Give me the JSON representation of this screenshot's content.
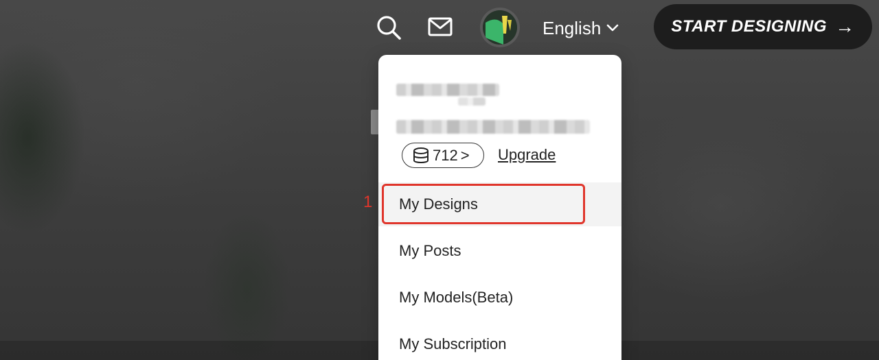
{
  "header": {
    "language": "English",
    "cta_label": "START DESIGNING",
    "cta_arrow": "→",
    "icons": {
      "search": "search-icon",
      "mail": "mail-icon",
      "chevron": "chevron-down-icon",
      "credits": "database-icon"
    }
  },
  "dropdown": {
    "credits": "712",
    "credits_suffix": ">",
    "upgrade_label": "Upgrade",
    "items": [
      {
        "label": "My Designs"
      },
      {
        "label": "My Posts"
      },
      {
        "label": "My Models(Beta)"
      },
      {
        "label": "My Subscription"
      }
    ]
  },
  "annotation": {
    "number": "1",
    "color": "#e0352b"
  },
  "colors": {
    "cta_bg": "#1d1d1d",
    "menu_bg": "#ffffff",
    "highlight": "#e0352b"
  }
}
